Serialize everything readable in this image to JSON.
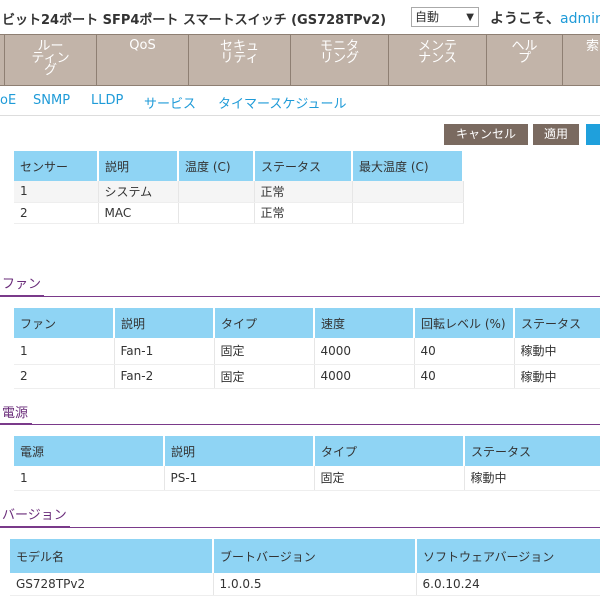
{
  "header": {
    "product_title": "ビット24ポート SFP4ポート スマートスイッチ (GS728TPv2)",
    "language": "自動",
    "welcome": "ようこそ、",
    "user": "admin"
  },
  "main_nav": [
    {
      "label": "ルー\nティン\nグ"
    },
    {
      "label": "QoS"
    },
    {
      "label": "セキュ\nリティ"
    },
    {
      "label": "モニタ\nリング"
    },
    {
      "label": "メンテ\nナンス"
    },
    {
      "label": "ヘル\nプ"
    },
    {
      "label": "索"
    }
  ],
  "sub_nav": [
    {
      "label": "oE"
    },
    {
      "label": "SNMP"
    },
    {
      "label": "LLDP"
    },
    {
      "label": "サービス"
    },
    {
      "label": "タイマースケジュール"
    }
  ],
  "buttons": {
    "cancel": "キャンセル",
    "apply": "適用"
  },
  "sensors": {
    "headers": [
      "センサー",
      "説明",
      "温度 (C)",
      "ステータス",
      "最大温度 (C)"
    ],
    "rows": [
      [
        "1",
        "システム",
        "",
        "正常",
        ""
      ],
      [
        "2",
        "MAC",
        "",
        "正常",
        ""
      ]
    ]
  },
  "fan": {
    "title": "ファン",
    "headers": [
      "ファン",
      "説明",
      "タイプ",
      "速度",
      "回転レベル (%)",
      "ステータス"
    ],
    "rows": [
      [
        "1",
        "Fan-1",
        "固定",
        "4000",
        "40",
        "稼動中"
      ],
      [
        "2",
        "Fan-2",
        "固定",
        "4000",
        "40",
        "稼動中"
      ]
    ]
  },
  "power": {
    "title": "電源",
    "headers": [
      "電源",
      "説明",
      "タイプ",
      "ステータス"
    ],
    "rows": [
      [
        "1",
        "PS-1",
        "固定",
        "稼動中"
      ]
    ]
  },
  "version": {
    "title": "バージョン",
    "headers": [
      "モデル名",
      "ブートバージョン",
      "ソフトウェアバージョン"
    ],
    "rows": [
      [
        "GS728TPv2",
        "1.0.0.5",
        "6.0.10.24"
      ]
    ]
  }
}
